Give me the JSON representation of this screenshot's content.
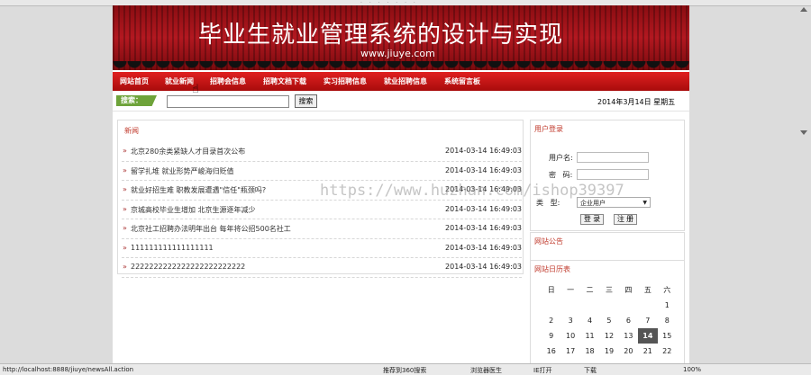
{
  "banner": {
    "title": "毕业生就业管理系统的设计与实现",
    "url": "www.jiuye.com"
  },
  "nav": [
    "网站首页",
    "就业新闻",
    "招聘会信息",
    "招聘文档下载",
    "实习招聘信息",
    "就业招聘信息",
    "系统留言板"
  ],
  "search": {
    "label": "搜索：",
    "button": "搜索",
    "value": ""
  },
  "date": "2014年3月14日 星期五",
  "news": {
    "title": "新闻",
    "items": [
      {
        "title": "北京280余类紧缺人才目录首次公布",
        "time": "2014-03-14 16:49:03"
      },
      {
        "title": "留学扎堆 就业形势严峻海归贬值",
        "time": "2014-03-14 16:49:03"
      },
      {
        "title": "就业好招生难 职教发展遭遇\"信任\"瓶颈吗?",
        "time": "2014-03-14 16:49:03"
      },
      {
        "title": "京城高校毕业生增加 北京生源逐年减少",
        "time": "2014-03-14 16:49:03"
      },
      {
        "title": "北京社工招聘办法明年出台 每年将公招500名社工",
        "time": "2014-03-14 16:49:03"
      },
      {
        "title": "111111111111111111",
        "time": "2014-03-14 16:49:03"
      },
      {
        "title": "2222222222222222222222222",
        "time": "2014-03-14 16:49:03"
      }
    ]
  },
  "login": {
    "title": "用户登录",
    "username_label": "用户名:",
    "password_label": "密   码:",
    "type_label": "类   型:",
    "type_value": "企业用户",
    "login_button": "登 录",
    "register_button": "注 册"
  },
  "notice": {
    "title": "网站公告"
  },
  "calendar": {
    "title": "网站日历表",
    "weekdays": [
      "日",
      "一",
      "二",
      "三",
      "四",
      "五",
      "六"
    ],
    "weeks": [
      [
        "",
        "",
        "",
        "",
        "",
        "",
        "1"
      ],
      [
        "2",
        "3",
        "4",
        "5",
        "6",
        "7",
        "8"
      ],
      [
        "9",
        "10",
        "11",
        "12",
        "13",
        "14",
        "15"
      ],
      [
        "16",
        "17",
        "18",
        "19",
        "20",
        "21",
        "22"
      ]
    ],
    "today": "14"
  },
  "status": {
    "url": "http://localhost:8888/jiuye/newsAll.action",
    "items": [
      "推荐到360搜索",
      "浏览器医生",
      "IE打开",
      "下载",
      "100%"
    ]
  },
  "watermark": "https://www.huzhan.com/ishop39397"
}
